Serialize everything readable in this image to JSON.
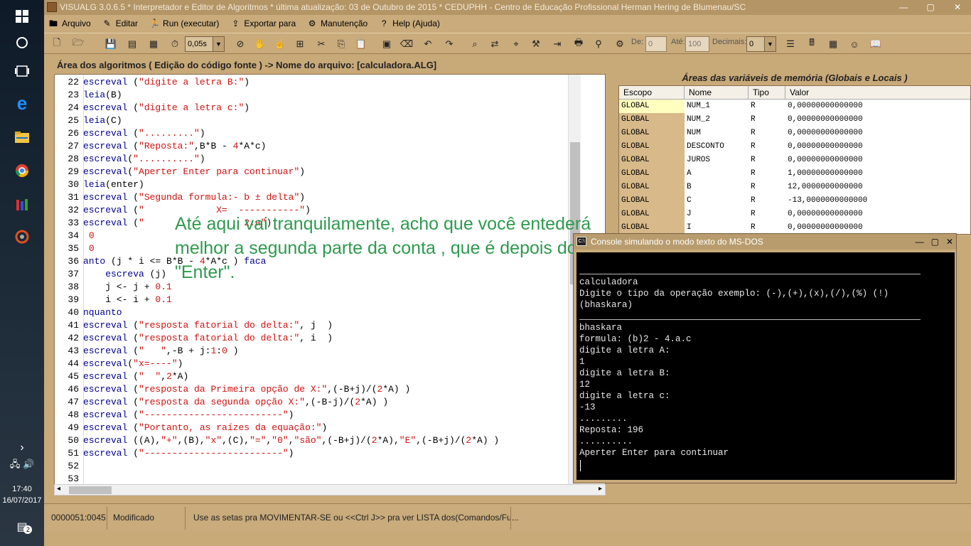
{
  "window": {
    "title": "VISUALG 3.0.6.5 * Interpretador e Editor de Algoritmos * última atualização: 03 de Outubro de 2015 * CEDUPHH - Centro de Educação Profissional Herman Hering de Blumenau/SC"
  },
  "menu": [
    {
      "label": "Arquivo",
      "icon": "folder-icon"
    },
    {
      "label": "Editar",
      "icon": "edit-icon"
    },
    {
      "label": "Run (executar)",
      "icon": "run-icon"
    },
    {
      "label": "Exportar para",
      "icon": "export-icon"
    },
    {
      "label": "Manutenção",
      "icon": "gears-icon"
    },
    {
      "label": "Help (Ajuda)",
      "icon": "help-icon"
    }
  ],
  "toolbar": {
    "speed": "0,05s",
    "de_label": "De:",
    "de_value": "0",
    "ate_label": "Até:",
    "ate_value": "100",
    "decimais_label": "Decimais:",
    "decimais_value": "0"
  },
  "editor": {
    "header": "Área dos algoritmos ( Edição do código fonte ) -> Nome do arquivo: [calculadora.ALG]",
    "lines": [
      {
        "n": "22",
        "code": [
          [
            "kw",
            "escreval"
          ],
          [
            "t",
            " ("
          ],
          [
            "str",
            "\"digite a letra B:\""
          ],
          [
            "t",
            ")"
          ]
        ]
      },
      {
        "n": "23",
        "code": [
          [
            "kw",
            "leia"
          ],
          [
            "t",
            "(B)"
          ]
        ]
      },
      {
        "n": "24",
        "code": [
          [
            "kw",
            "escreval"
          ],
          [
            "t",
            " ("
          ],
          [
            "str",
            "\"digite a letra c:\""
          ],
          [
            "t",
            ")"
          ]
        ]
      },
      {
        "n": "25",
        "code": [
          [
            "kw",
            "leia"
          ],
          [
            "t",
            "(C)"
          ]
        ]
      },
      {
        "n": "26",
        "code": [
          [
            "kw",
            "escreval"
          ],
          [
            "t",
            " ("
          ],
          [
            "str",
            "\".........\""
          ],
          [
            "t",
            ")"
          ]
        ]
      },
      {
        "n": "27",
        "code": [
          [
            "kw",
            "escreval"
          ],
          [
            "t",
            " ("
          ],
          [
            "str",
            "\"Reposta:\""
          ],
          [
            "t",
            ",B*B - "
          ],
          [
            "num",
            "4"
          ],
          [
            "t",
            "*A*c)"
          ]
        ]
      },
      {
        "n": "28",
        "code": [
          [
            "kw",
            "escreval"
          ],
          [
            "t",
            "("
          ],
          [
            "str",
            "\"..........\""
          ],
          [
            "t",
            ")"
          ]
        ]
      },
      {
        "n": "29",
        "code": [
          [
            "kw",
            "escreval"
          ],
          [
            "t",
            "("
          ],
          [
            "str",
            "\"Aperter Enter para continuar\""
          ],
          [
            "t",
            ")"
          ]
        ]
      },
      {
        "n": "30",
        "code": [
          [
            "kw",
            "leia"
          ],
          [
            "t",
            "(enter)"
          ]
        ]
      },
      {
        "n": "31",
        "code": [
          [
            "kw",
            "escreval"
          ],
          [
            "t",
            " ("
          ],
          [
            "str",
            "\"Segunda formula:- b ± delta\""
          ],
          [
            "t",
            ")"
          ]
        ]
      },
      {
        "n": "32",
        "code": [
          [
            "kw",
            "escreval"
          ],
          [
            "t",
            " ("
          ],
          [
            "str",
            "\"             X=  -----------\""
          ],
          [
            "t",
            ")"
          ]
        ]
      },
      {
        "n": "33",
        "code": [
          [
            "kw",
            "escreval"
          ],
          [
            "t",
            " ("
          ],
          [
            "str",
            "\"                  2.a\""
          ],
          [
            "t",
            ")"
          ]
        ]
      },
      {
        "n": "34",
        "code": [
          [
            "t",
            " "
          ],
          [
            "num",
            "0"
          ]
        ]
      },
      {
        "n": "35",
        "code": [
          [
            "t",
            " "
          ],
          [
            "num",
            "0"
          ]
        ]
      },
      {
        "n": "36",
        "code": [
          [
            "kw",
            "anto"
          ],
          [
            "t",
            " (j * i <= B*B - "
          ],
          [
            "num",
            "4"
          ],
          [
            "t",
            "*A*c ) "
          ],
          [
            "kw",
            "faca"
          ]
        ]
      },
      {
        "n": "37",
        "code": [
          [
            "t",
            "    "
          ],
          [
            "kw",
            "escreva"
          ],
          [
            "t",
            " (j)"
          ]
        ]
      },
      {
        "n": "38",
        "code": [
          [
            "t",
            "    j <- j + "
          ],
          [
            "num",
            "0.1"
          ]
        ]
      },
      {
        "n": "39",
        "code": [
          [
            "t",
            "    i <- i + "
          ],
          [
            "num",
            "0.1"
          ]
        ]
      },
      {
        "n": "40",
        "code": [
          [
            "kw",
            "nquanto"
          ]
        ]
      },
      {
        "n": "41",
        "code": [
          [
            "kw",
            "escreval"
          ],
          [
            "t",
            " ("
          ],
          [
            "str",
            "\"resposta fatorial do delta:\""
          ],
          [
            "t",
            ", j  )"
          ]
        ]
      },
      {
        "n": "42",
        "code": [
          [
            "kw",
            "escreval"
          ],
          [
            "t",
            " ("
          ],
          [
            "str",
            "\"resposta fatorial do delta:\""
          ],
          [
            "t",
            ", i  )"
          ]
        ]
      },
      {
        "n": "43",
        "code": [
          [
            "kw",
            "escreval"
          ],
          [
            "t",
            " ("
          ],
          [
            "str",
            "\"   \""
          ],
          [
            "t",
            ",-B + j:"
          ],
          [
            "num",
            "1"
          ],
          [
            "t",
            ":"
          ],
          [
            "num",
            "0"
          ],
          [
            "t",
            " )"
          ]
        ]
      },
      {
        "n": "44",
        "code": [
          [
            "kw",
            "escreval"
          ],
          [
            "t",
            "("
          ],
          [
            "str",
            "\"x=----\""
          ],
          [
            "t",
            ")"
          ]
        ]
      },
      {
        "n": "45",
        "code": [
          [
            "kw",
            "escreval"
          ],
          [
            "t",
            " ("
          ],
          [
            "str",
            "\"  \""
          ],
          [
            "t",
            ","
          ],
          [
            "num",
            "2"
          ],
          [
            "t",
            "*A)"
          ]
        ]
      },
      {
        "n": "46",
        "code": [
          [
            "kw",
            "escreval"
          ],
          [
            "t",
            " ("
          ],
          [
            "str",
            "\"resposta da Primeira opção de X:\""
          ],
          [
            "t",
            ",(-B+j)/("
          ],
          [
            "num",
            "2"
          ],
          [
            "t",
            "*A) )"
          ]
        ]
      },
      {
        "n": "47",
        "code": [
          [
            "kw",
            "escreval"
          ],
          [
            "t",
            " ("
          ],
          [
            "str",
            "\"resposta da segunda opção X:\""
          ],
          [
            "t",
            ",(-B-j)/("
          ],
          [
            "num",
            "2"
          ],
          [
            "t",
            "*A) )"
          ]
        ]
      },
      {
        "n": "48",
        "code": [
          [
            "kw",
            "escreval"
          ],
          [
            "t",
            " ("
          ],
          [
            "str",
            "\"-------------------------\""
          ],
          [
            "t",
            ")"
          ]
        ]
      },
      {
        "n": "49",
        "code": [
          [
            "kw",
            "escreval"
          ],
          [
            "t",
            " ("
          ],
          [
            "str",
            "\"Portanto, as raízes da equação:\""
          ],
          [
            "t",
            ")"
          ]
        ]
      },
      {
        "n": "50",
        "code": [
          [
            "kw",
            "escreval"
          ],
          [
            "t",
            " ((A),"
          ],
          [
            "str",
            "\"+\""
          ],
          [
            "t",
            ",(B),"
          ],
          [
            "str",
            "\"x\""
          ],
          [
            "t",
            ",(C),"
          ],
          [
            "str",
            "\"=\""
          ],
          [
            "t",
            ","
          ],
          [
            "str",
            "\"0\""
          ],
          [
            "t",
            ","
          ],
          [
            "str",
            "\"são\""
          ],
          [
            "t",
            ",(-B+j)/("
          ],
          [
            "num",
            "2"
          ],
          [
            "t",
            "*A),"
          ],
          [
            "str",
            "\"E\""
          ],
          [
            "t",
            ",(-B+j)/("
          ],
          [
            "num",
            "2"
          ],
          [
            "t",
            "*A) )"
          ]
        ]
      },
      {
        "n": "51",
        "code": [
          [
            "kw",
            "escreval"
          ],
          [
            "t",
            " ("
          ],
          [
            "str",
            "\"-------------------------\""
          ],
          [
            "t",
            ")"
          ]
        ]
      },
      {
        "n": "52",
        "code": []
      },
      {
        "n": "53",
        "code": []
      }
    ]
  },
  "variables": {
    "header": "Áreas das variáveis de memória (Globais e Locais )",
    "columns": [
      "Escopo",
      "Nome",
      "Tipo",
      "Valor"
    ],
    "rows": [
      [
        "GLOBAL",
        "NUM_1",
        "R",
        "0,00000000000000"
      ],
      [
        "GLOBAL",
        "NUM_2",
        "R",
        "0,00000000000000"
      ],
      [
        "GLOBAL",
        "NUM",
        "R",
        "0,00000000000000"
      ],
      [
        "GLOBAL",
        "DESCONTO",
        "R",
        "0,00000000000000"
      ],
      [
        "GLOBAL",
        "JUROS",
        "R",
        "0,00000000000000"
      ],
      [
        "GLOBAL",
        "A",
        "R",
        "1,00000000000000"
      ],
      [
        "GLOBAL",
        "B",
        "R",
        "12,0000000000000"
      ],
      [
        "GLOBAL",
        "C",
        "R",
        "-13,0000000000000"
      ],
      [
        "GLOBAL",
        "J",
        "R",
        "0,00000000000000"
      ],
      [
        "GLOBAL",
        "I",
        "R",
        "0,00000000000000"
      ]
    ]
  },
  "annotation": "Até  aqui vai tranquilamente, acho que você entederá melhor a segunda parte da conta , que é depois do \"Enter\".",
  "console": {
    "title": "Console simulando o modo texto do MS-DOS",
    "lines": [
      "calculadora",
      "Digite o tipo da operação exemplo: (-),(+),(x),(/),(%) (!)",
      "(bhaskara)",
      "bhaskara",
      "formula: (b)2 - 4.a.c",
      "digite a letra A:",
      "1",
      "digite a letra B:",
      "12",
      "digite a letra c:",
      "-13",
      ".........",
      "Reposta: 196",
      "..........",
      "Aperter Enter para continuar"
    ]
  },
  "status": {
    "position": "0000051:0045",
    "state": "Modificado",
    "hint": "Use as setas pra MOVIMENTAR-SE ou <<Ctrl J>> pra ver LISTA dos(Comandos/Fu..."
  },
  "taskbar": {
    "time": "17:40",
    "date": "16/07/2017",
    "notifications": "2"
  }
}
